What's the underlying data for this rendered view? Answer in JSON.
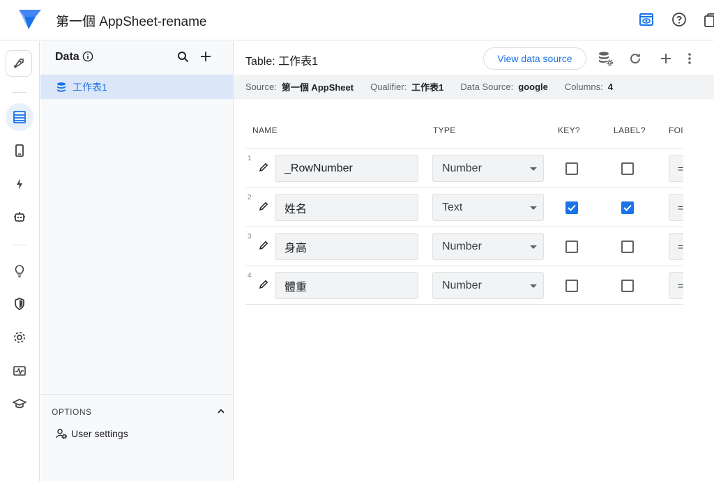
{
  "app": {
    "title": "第一個 AppSheet-rename"
  },
  "colors": {
    "accent": "#1a73e8",
    "selected_bg": "#dbe7f9",
    "panel_bg": "#f8f9fa"
  },
  "topbar": {
    "icons": [
      "preview-icon",
      "help-icon",
      "copy-icon"
    ]
  },
  "rail": {
    "items": [
      "deploy-icon",
      "data-icon",
      "views-icon",
      "automation-icon",
      "bots-icon",
      "intelligence-icon",
      "security-icon",
      "settings-icon",
      "monitor-icon",
      "learn-icon"
    ],
    "active": "data-icon"
  },
  "data_panel": {
    "title": "Data",
    "tables": [
      {
        "label": "工作表1"
      }
    ],
    "options": {
      "title": "OPTIONS",
      "items": [
        {
          "label": "User settings"
        }
      ]
    }
  },
  "main": {
    "title": "Table: 工作表1",
    "view_source_label": "View data source",
    "info": {
      "source_key": "Source:",
      "source_value": "第一個 AppSheet",
      "qualifier_key": "Qualifier:",
      "qualifier_value": "工作表1",
      "datasource_key": "Data Source:",
      "datasource_value": "google",
      "columns_key": "Columns:",
      "columns_value": "4"
    },
    "headers": {
      "name": "NAME",
      "type": "TYPE",
      "key": "KEY?",
      "label": "LABEL?",
      "formula": "FOI"
    },
    "rows": [
      {
        "num": "1",
        "name": "_RowNumber",
        "type": "Number",
        "key": false,
        "label": false,
        "formula": "="
      },
      {
        "num": "2",
        "name": "姓名",
        "type": "Text",
        "key": true,
        "label": true,
        "formula": "="
      },
      {
        "num": "3",
        "name": "身高",
        "type": "Number",
        "key": false,
        "label": false,
        "formula": "="
      },
      {
        "num": "4",
        "name": "體重",
        "type": "Number",
        "key": false,
        "label": false,
        "formula": "="
      }
    ]
  }
}
